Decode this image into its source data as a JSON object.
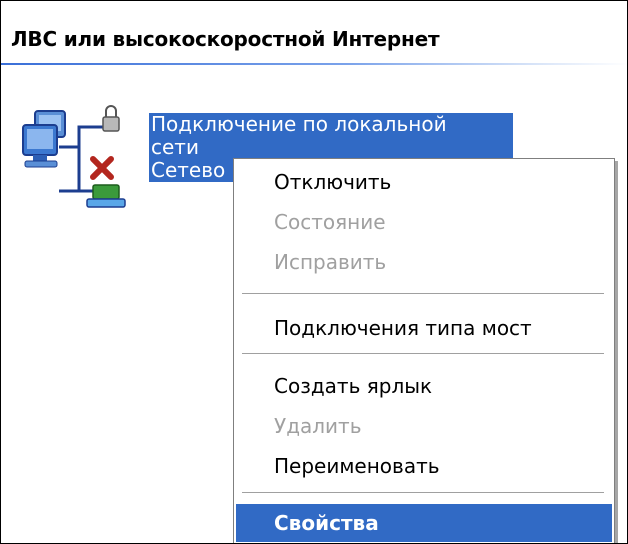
{
  "group": {
    "title": "ЛВС или высокоскоростной Интернет"
  },
  "connection": {
    "name_line1": "Подключение по локальной",
    "name_line2": "сети",
    "name_line3": "Сетево",
    "icon": "network-connection-disconnected-icon"
  },
  "context_menu": {
    "items": [
      {
        "label": "Отключить",
        "state": "enabled"
      },
      {
        "label": "Состояние",
        "state": "disabled"
      },
      {
        "label": "Исправить",
        "state": "disabled"
      },
      {
        "label": "Подключения типа мост",
        "state": "enabled"
      },
      {
        "label": "Создать ярлык",
        "state": "enabled"
      },
      {
        "label": "Удалить",
        "state": "disabled"
      },
      {
        "label": "Переименовать",
        "state": "enabled"
      },
      {
        "label": "Свойства",
        "state": "default-selected"
      }
    ]
  },
  "colors": {
    "selection": "#316ac5",
    "disabled_text": "#a0a0a0",
    "header_rule": "#3a6fd8"
  }
}
